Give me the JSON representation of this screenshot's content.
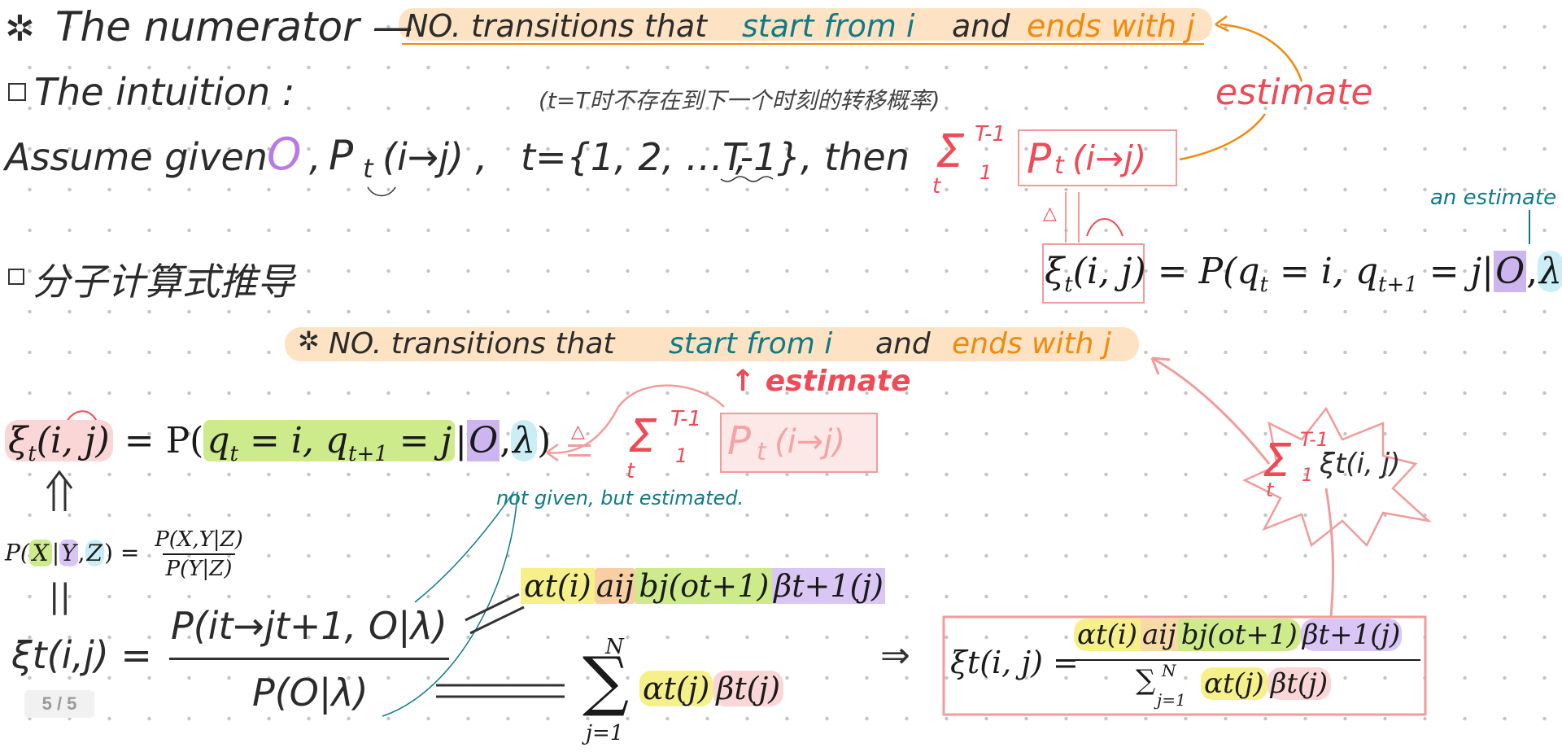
{
  "heading": {
    "prefix": "The numerator —",
    "text_a": "NO. transitions that",
    "text_b": "start from i",
    "text_c": "and",
    "text_d": "ends with j"
  },
  "estimate_label": "estimate",
  "intuition_label": "The intuition :",
  "chinese_note": "(t=T时不存在到下一个时刻的转移概率)",
  "assume": {
    "lead": "Assume given",
    "O": "O",
    "P_term": "P",
    "P_sub": "t",
    "P_arg": "(i→j) ,",
    "t_set": "t={1, 2, … ,",
    "t_last": "T-1}",
    "then": ", then"
  },
  "sum_top": {
    "sigma": "Σ",
    "upper": "T-1",
    "lower_t": "t",
    "lower_1": "1",
    "term": "P",
    "term_sub": "t",
    "term_arg": "(i→j)"
  },
  "def_marker": "△",
  "an_estimate": "an estimate",
  "xi_def": {
    "xi": "ξ",
    "sub": "t",
    "args": "(i, j) = P(q",
    "qt_sub": "t",
    "mid": " = i, q",
    "q1_sub": "t+1",
    "end": " = j|",
    "O": "O",
    "comma": ",",
    "lambda": "λ",
    "close": ")"
  },
  "derivation_label": "分子计算式推导",
  "subheading": {
    "text_a": "NO. transitions that",
    "text_b": "start from i",
    "text_c": "and",
    "text_d": "ends with j"
  },
  "estimate_arrow_label": "↑ estimate",
  "left_xi": {
    "xi": "ξ",
    "sub": "t",
    "args": "(i, j)",
    "eq": "= P(",
    "q_part": "q",
    "qt_sub": "t",
    "q_mid": " = i, q",
    "q1_sub": "t+1",
    "q_end": " = j",
    "bar": "|",
    "O": "O",
    "comma": ",",
    "lambda": "λ",
    "close": ")"
  },
  "not_given_note": "not given, but estimated.",
  "bayes": {
    "lhs": "P(",
    "X": "X",
    "bar": "|",
    "Y": "Y",
    "comma": ",",
    "Z": "Z",
    "close": ") =",
    "num": "P(X,Y|Z)",
    "den": "P(Y|Z)"
  },
  "equals_vertical": "||",
  "xi_frac": {
    "lhs": "ξt(i,j) =",
    "num": "P(it→jt+1, O|λ)",
    "den": "P(O|λ)"
  },
  "numerator_product": {
    "alpha": "αt(i)",
    "a": "aij",
    "b": "bj(ot+1)",
    "beta": "βt+1(j)"
  },
  "denominator_sum": {
    "upper": "N",
    "lower": "j=1",
    "alpha": "αt(j)",
    "beta": "βt(j)"
  },
  "implies": "⇒",
  "final": {
    "lhs": "ξt(i, j) =",
    "num_alpha": "αt(i)",
    "num_a": "aij",
    "num_b": "bj(ot+1)",
    "num_beta": "βt+1(j)",
    "den_sum": "∑",
    "den_upper": "N",
    "den_lower": "j=1",
    "den_alpha": "αt(j)",
    "den_beta": "βt(j)"
  },
  "burst": {
    "upper": "T-1",
    "lower_t": "t",
    "lower_1": "1",
    "term": "ξt(i, j)"
  },
  "page_indicator": "5 / 5",
  "colors": {
    "teal": "#0f7b86",
    "orange": "#f08a0c",
    "red": "#ef4a55",
    "yellow_highlight": "#f6f08a",
    "green_highlight": "#cdeb8b",
    "purple_highlight": "#d9c6f5",
    "cyan_highlight": "#cbeef6",
    "peach_highlight": "#fde3c4"
  }
}
